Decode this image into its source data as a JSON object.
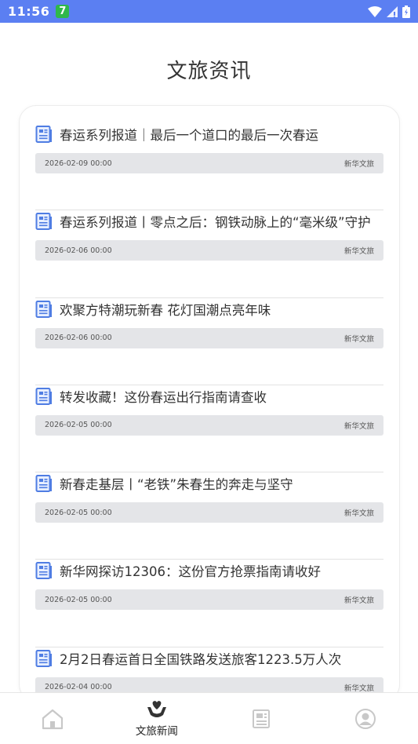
{
  "status_bar": {
    "time": "11:56",
    "badge": "7"
  },
  "page": {
    "title": "文旅资讯"
  },
  "news": [
    {
      "title": "春运系列报道｜最后一个道口的最后一次春运",
      "date": "2026-02-09 00:00",
      "source": "新华文旅"
    },
    {
      "title": "春运系列报道丨零点之后：钢铁动脉上的“毫米级”守护",
      "date": "2026-02-06 00:00",
      "source": "新华文旅"
    },
    {
      "title": "欢聚方特潮玩新春 花灯国潮点亮年味",
      "date": "2026-02-06 00:00",
      "source": "新华文旅"
    },
    {
      "title": "转发收藏！这份春运出行指南请查收",
      "date": "2026-02-05 00:00",
      "source": "新华文旅"
    },
    {
      "title": "新春走基层丨“老铁”朱春生的奔走与坚守",
      "date": "2026-02-05 00:00",
      "source": "新华文旅"
    },
    {
      "title": "新华网探访12306：这份官方抢票指南请收好",
      "date": "2026-02-05 00:00",
      "source": "新华文旅"
    },
    {
      "title": "2月2日春运首日全国铁路发送旅客1223.5万人次",
      "date": "2026-02-04 00:00",
      "source": "新华文旅"
    }
  ],
  "tab_bar": {
    "tabs": [
      {
        "icon": "home-icon",
        "label": ""
      },
      {
        "icon": "heart-hand-icon",
        "label": "文旅新闻"
      },
      {
        "icon": "newspaper-icon",
        "label": ""
      },
      {
        "icon": "user-icon",
        "label": ""
      }
    ]
  },
  "colors": {
    "status_bar": "#5b7ff2",
    "doc_icon": "#4f7de3",
    "meta_bar": "#e4e5e8",
    "inactive_icon": "#c8c8c8"
  }
}
